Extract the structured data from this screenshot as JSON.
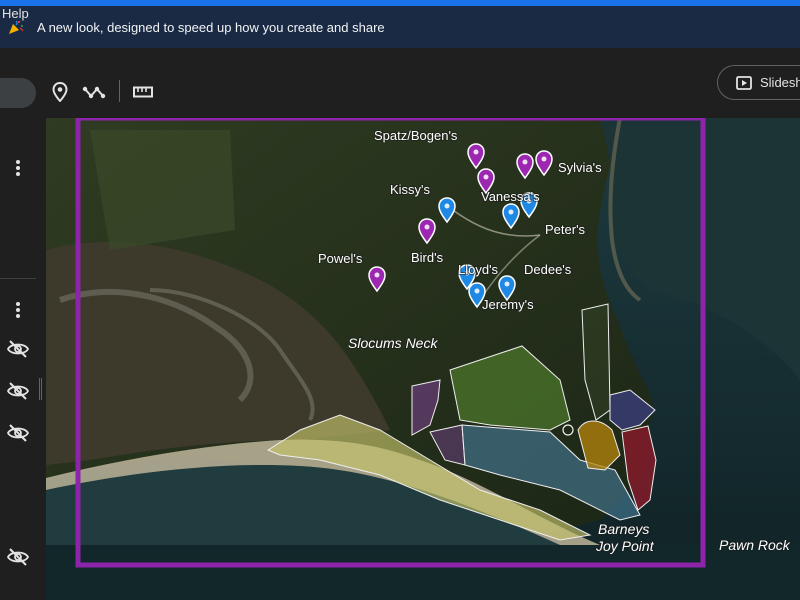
{
  "banner": {
    "text": "A new look, designed to speed up how you create and share",
    "icon": "party-popper-icon"
  },
  "menu": {
    "help": "Help"
  },
  "toolbar": {
    "tools": [
      {
        "name": "add-marker-icon"
      },
      {
        "name": "draw-line-icon"
      },
      {
        "name": "measure-ruler-icon"
      }
    ],
    "slideshow_label": "Slideshow"
  },
  "sidebar": {
    "icons": [
      "more-vert-icon",
      "more-vert-icon",
      "visibility-off-icon",
      "visibility-off-icon",
      "visibility-off-icon",
      "visibility-off-icon"
    ]
  },
  "colors": {
    "banner_bg": "#1b2a44",
    "accent_blue": "#1a73e8",
    "marker_purple": "#9c27b0",
    "marker_blue": "#1e88e5",
    "boundary_purple": "#8e24aa"
  },
  "map": {
    "place_labels": [
      "Spatz/Bogen's",
      "Sylvia's",
      "Kissy's",
      "Vanessa's",
      "Peter's",
      "Powel's",
      "Bird's",
      "Lloyd's",
      "Dedee's",
      "Jeremy's",
      "Barneys",
      "Joy Point",
      "Pawn Rock"
    ],
    "area_labels": [
      "Slocums Neck"
    ],
    "marker_colors": [
      "purple",
      "purple",
      "purple",
      "purple",
      "purple",
      "purple",
      "blue",
      "blue",
      "blue",
      "blue",
      "blue",
      "blue"
    ]
  }
}
